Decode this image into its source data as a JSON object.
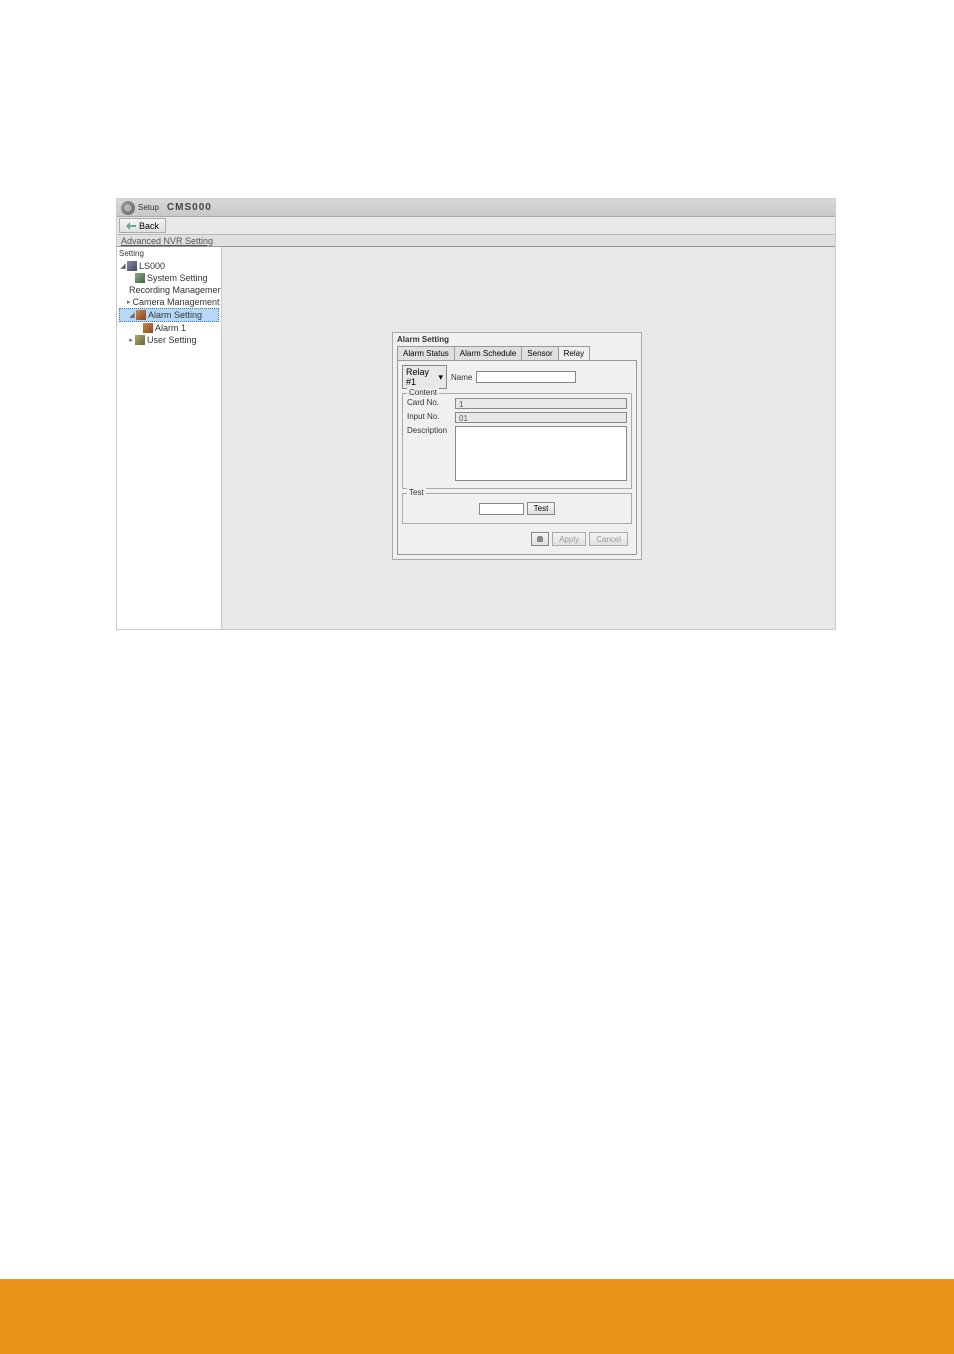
{
  "header": {
    "setup_label": "Setup",
    "app_title": "CMS000"
  },
  "toolbar": {
    "back_label": "Back"
  },
  "advanced_label": "Advanced NVR Setting",
  "sidebar": {
    "header": "Setting",
    "tree": {
      "root_label": "LS000",
      "items": [
        {
          "label": "System Setting"
        },
        {
          "label": "Recording Management"
        },
        {
          "label": "Camera Management"
        },
        {
          "label": "Alarm Setting",
          "selected": true
        },
        {
          "label": "Alarm 1",
          "child": true
        },
        {
          "label": "User Setting"
        }
      ]
    }
  },
  "alarm_panel": {
    "title": "Alarm Setting",
    "tabs": [
      {
        "label": "Alarm Status"
      },
      {
        "label": "Alarm Schedule"
      },
      {
        "label": "Sensor"
      },
      {
        "label": "Relay",
        "active": true
      }
    ],
    "relay_selector": "Relay #1",
    "name_label": "Name",
    "name_value": "",
    "content": {
      "legend": "Content",
      "card_label": "Card No.",
      "card_value": "1",
      "input_label": "Input No.",
      "input_value": "01",
      "desc_label": "Description",
      "desc_value": ""
    },
    "test": {
      "legend": "Test",
      "button_label": "Test"
    },
    "buttons": {
      "apply": "Apply",
      "cancel": "Cancel"
    }
  }
}
